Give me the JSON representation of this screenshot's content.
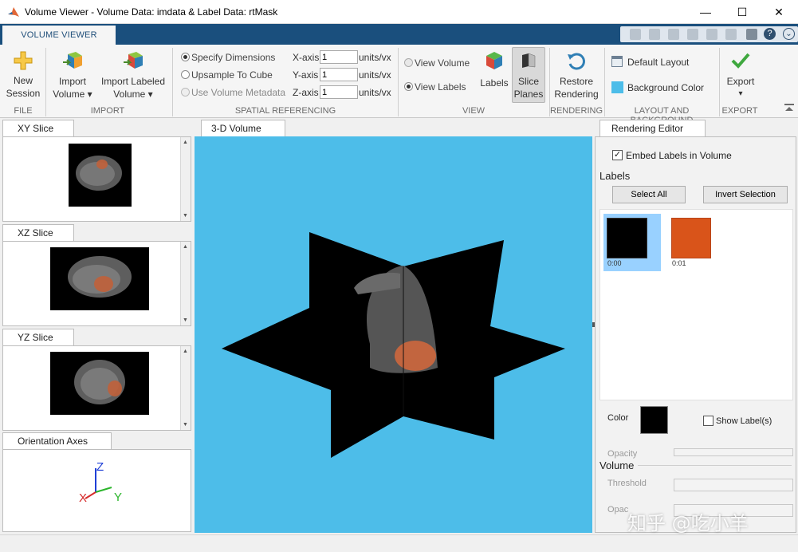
{
  "window": {
    "title": "Volume Viewer - Volume Data: imdata & Label Data: rtMask",
    "minimize": "—",
    "maximize": "☐",
    "close": "✕"
  },
  "toolstrip": {
    "tab": "VOLUME VIEWER"
  },
  "ribbon": {
    "file": {
      "group_label": "FILE",
      "new_session": [
        "New",
        "Session"
      ]
    },
    "import": {
      "group_label": "IMPORT",
      "import_volume": [
        "Import",
        "Volume ▾"
      ],
      "import_labeled": [
        "Import Labeled",
        "Volume ▾"
      ]
    },
    "spatial": {
      "group_label": "SPATIAL REFERENCING",
      "specify_dimensions": "Specify Dimensions",
      "upsample": "Upsample To Cube",
      "use_metadata": "Use Volume Metadata",
      "x_label": "X-axis",
      "y_label": "Y-axis",
      "z_label": "Z-axis",
      "x_value": "1",
      "y_value": "1",
      "z_value": "1",
      "units": "units/vx"
    },
    "view": {
      "group_label": "VIEW",
      "view_volume": "View Volume",
      "view_labels": "View Labels",
      "labels": "Labels",
      "slice_planes": [
        "Slice",
        "Planes"
      ]
    },
    "rendering": {
      "group_label": "RENDERING",
      "restore": [
        "Restore",
        "Rendering"
      ]
    },
    "layout": {
      "group_label": "LAYOUT AND BACKGROUND",
      "default_layout": "Default Layout",
      "background_color": "Background Color"
    },
    "export": {
      "group_label": "EXPORT",
      "export": "Export",
      "arrow": "▾"
    }
  },
  "panels": {
    "xy": "XY Slice",
    "xz": "XZ Slice",
    "yz": "YZ Slice",
    "orientation": "Orientation Axes",
    "volume3d": "3-D Volume",
    "axes": {
      "x": "X",
      "y": "Y",
      "z": "Z"
    }
  },
  "editor": {
    "tab": "Rendering Editor",
    "embed_labels": "Embed Labels in Volume",
    "labels_heading": "Labels",
    "select_all": "Select All",
    "invert_selection": "Invert Selection",
    "swatches": [
      {
        "id": "0:00",
        "color": "#000000"
      },
      {
        "id": "0:01",
        "color": "#d9541a"
      }
    ],
    "color_label": "Color",
    "show_labels": "Show Label(s)",
    "opacity": "Opacity",
    "volume_heading": "Volume",
    "threshold": "Threshold",
    "opacity2": "Opac"
  },
  "watermark": "知乎 @吃小羊",
  "colors": {
    "accent": "#1a4f7d",
    "viewport_bg": "#4dbde9",
    "label_orange": "#d9541a",
    "selection_blue": "#99d1ff"
  }
}
